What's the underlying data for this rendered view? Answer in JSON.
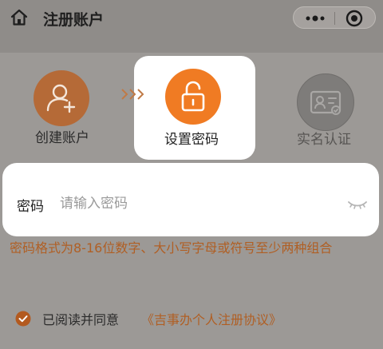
{
  "header": {
    "title": "注册账户"
  },
  "steps": [
    {
      "label": "创建账户",
      "icon": "user-add-icon",
      "state": "done"
    },
    {
      "label": "设置密码",
      "icon": "unlock-icon",
      "state": "active"
    },
    {
      "label": "实名认证",
      "icon": "id-card-icon",
      "state": "pending"
    }
  ],
  "form": {
    "password_label": "密码",
    "password_placeholder": "请输入密码",
    "password_value": ""
  },
  "rule_text": "密码格式为8-16位数字、大小写字母或符号至少两种组合",
  "agreement": {
    "text": "已阅读并同意",
    "link": "《吉事办个人注册协议》",
    "checked": true
  },
  "colors": {
    "accent": "#f07b23",
    "accent_dim": "#b56a37",
    "rule_text": "#b05f24",
    "overlay": "#8f8c89"
  }
}
